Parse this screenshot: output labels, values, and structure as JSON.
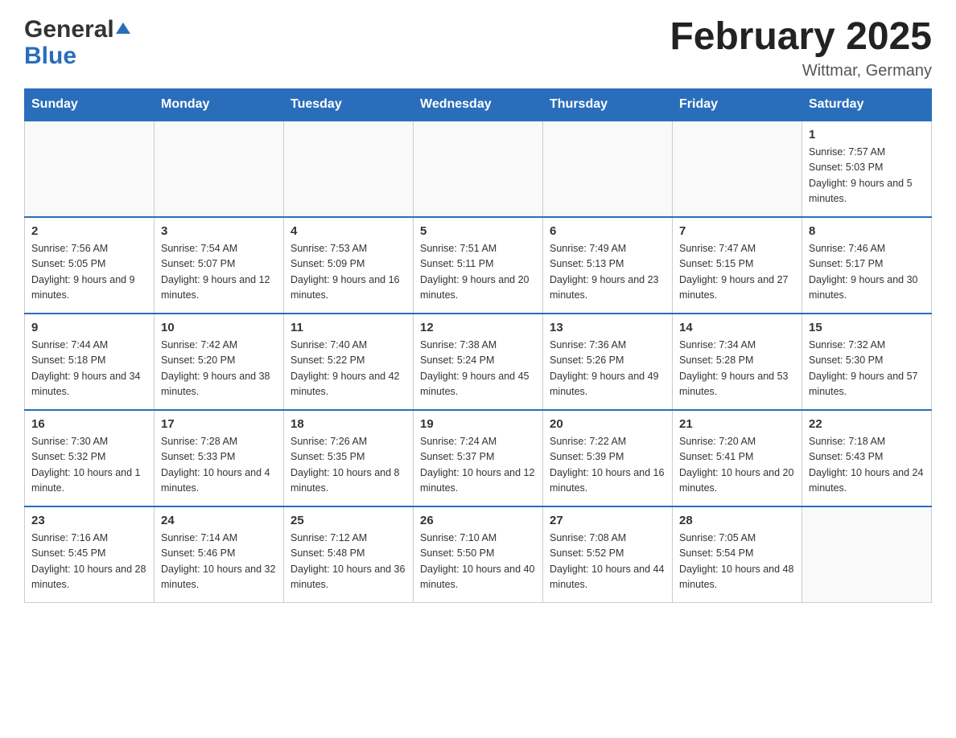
{
  "header": {
    "logo_general": "General",
    "logo_blue": "Blue",
    "month_title": "February 2025",
    "location": "Wittmar, Germany"
  },
  "calendar": {
    "days_of_week": [
      "Sunday",
      "Monday",
      "Tuesday",
      "Wednesday",
      "Thursday",
      "Friday",
      "Saturday"
    ],
    "weeks": [
      {
        "days": [
          {
            "num": "",
            "info": "",
            "empty": true
          },
          {
            "num": "",
            "info": "",
            "empty": true
          },
          {
            "num": "",
            "info": "",
            "empty": true
          },
          {
            "num": "",
            "info": "",
            "empty": true
          },
          {
            "num": "",
            "info": "",
            "empty": true
          },
          {
            "num": "",
            "info": "",
            "empty": true
          },
          {
            "num": "1",
            "info": "Sunrise: 7:57 AM\nSunset: 5:03 PM\nDaylight: 9 hours and 5 minutes."
          }
        ]
      },
      {
        "days": [
          {
            "num": "2",
            "info": "Sunrise: 7:56 AM\nSunset: 5:05 PM\nDaylight: 9 hours and 9 minutes."
          },
          {
            "num": "3",
            "info": "Sunrise: 7:54 AM\nSunset: 5:07 PM\nDaylight: 9 hours and 12 minutes."
          },
          {
            "num": "4",
            "info": "Sunrise: 7:53 AM\nSunset: 5:09 PM\nDaylight: 9 hours and 16 minutes."
          },
          {
            "num": "5",
            "info": "Sunrise: 7:51 AM\nSunset: 5:11 PM\nDaylight: 9 hours and 20 minutes."
          },
          {
            "num": "6",
            "info": "Sunrise: 7:49 AM\nSunset: 5:13 PM\nDaylight: 9 hours and 23 minutes."
          },
          {
            "num": "7",
            "info": "Sunrise: 7:47 AM\nSunset: 5:15 PM\nDaylight: 9 hours and 27 minutes."
          },
          {
            "num": "8",
            "info": "Sunrise: 7:46 AM\nSunset: 5:17 PM\nDaylight: 9 hours and 30 minutes."
          }
        ]
      },
      {
        "days": [
          {
            "num": "9",
            "info": "Sunrise: 7:44 AM\nSunset: 5:18 PM\nDaylight: 9 hours and 34 minutes."
          },
          {
            "num": "10",
            "info": "Sunrise: 7:42 AM\nSunset: 5:20 PM\nDaylight: 9 hours and 38 minutes."
          },
          {
            "num": "11",
            "info": "Sunrise: 7:40 AM\nSunset: 5:22 PM\nDaylight: 9 hours and 42 minutes."
          },
          {
            "num": "12",
            "info": "Sunrise: 7:38 AM\nSunset: 5:24 PM\nDaylight: 9 hours and 45 minutes."
          },
          {
            "num": "13",
            "info": "Sunrise: 7:36 AM\nSunset: 5:26 PM\nDaylight: 9 hours and 49 minutes."
          },
          {
            "num": "14",
            "info": "Sunrise: 7:34 AM\nSunset: 5:28 PM\nDaylight: 9 hours and 53 minutes."
          },
          {
            "num": "15",
            "info": "Sunrise: 7:32 AM\nSunset: 5:30 PM\nDaylight: 9 hours and 57 minutes."
          }
        ]
      },
      {
        "days": [
          {
            "num": "16",
            "info": "Sunrise: 7:30 AM\nSunset: 5:32 PM\nDaylight: 10 hours and 1 minute."
          },
          {
            "num": "17",
            "info": "Sunrise: 7:28 AM\nSunset: 5:33 PM\nDaylight: 10 hours and 4 minutes."
          },
          {
            "num": "18",
            "info": "Sunrise: 7:26 AM\nSunset: 5:35 PM\nDaylight: 10 hours and 8 minutes."
          },
          {
            "num": "19",
            "info": "Sunrise: 7:24 AM\nSunset: 5:37 PM\nDaylight: 10 hours and 12 minutes."
          },
          {
            "num": "20",
            "info": "Sunrise: 7:22 AM\nSunset: 5:39 PM\nDaylight: 10 hours and 16 minutes."
          },
          {
            "num": "21",
            "info": "Sunrise: 7:20 AM\nSunset: 5:41 PM\nDaylight: 10 hours and 20 minutes."
          },
          {
            "num": "22",
            "info": "Sunrise: 7:18 AM\nSunset: 5:43 PM\nDaylight: 10 hours and 24 minutes."
          }
        ]
      },
      {
        "days": [
          {
            "num": "23",
            "info": "Sunrise: 7:16 AM\nSunset: 5:45 PM\nDaylight: 10 hours and 28 minutes."
          },
          {
            "num": "24",
            "info": "Sunrise: 7:14 AM\nSunset: 5:46 PM\nDaylight: 10 hours and 32 minutes."
          },
          {
            "num": "25",
            "info": "Sunrise: 7:12 AM\nSunset: 5:48 PM\nDaylight: 10 hours and 36 minutes."
          },
          {
            "num": "26",
            "info": "Sunrise: 7:10 AM\nSunset: 5:50 PM\nDaylight: 10 hours and 40 minutes."
          },
          {
            "num": "27",
            "info": "Sunrise: 7:08 AM\nSunset: 5:52 PM\nDaylight: 10 hours and 44 minutes."
          },
          {
            "num": "28",
            "info": "Sunrise: 7:05 AM\nSunset: 5:54 PM\nDaylight: 10 hours and 48 minutes."
          },
          {
            "num": "",
            "info": "",
            "empty": true
          }
        ]
      }
    ]
  }
}
